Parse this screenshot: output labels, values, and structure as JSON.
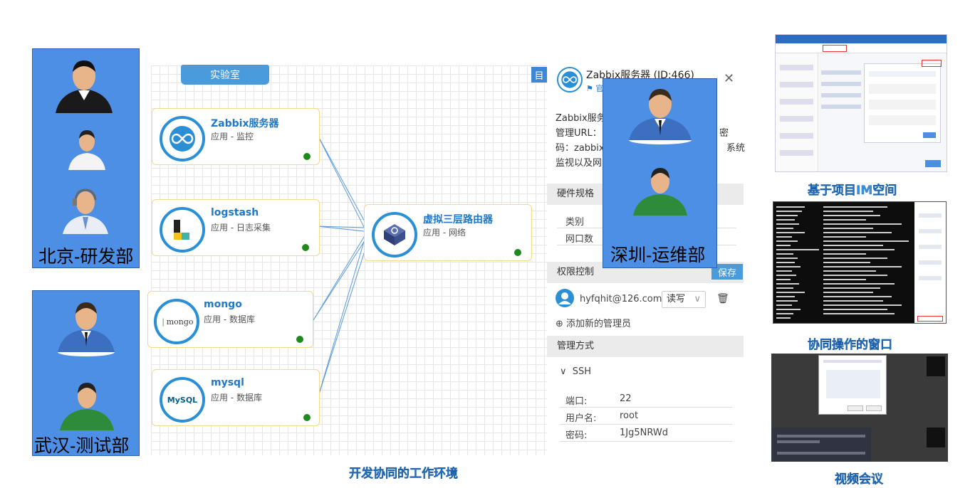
{
  "workspace": {
    "lab_tab": "实验室",
    "caption": "开发协同的工作环境",
    "corner_button": "目"
  },
  "nodes": [
    {
      "title": "Zabbix服务器",
      "subtitle": "应用 - 监控",
      "icon": "zabbix-infinity-icon"
    },
    {
      "title": "logstash",
      "subtitle": "应用 - 日志采集",
      "icon": "logstash-icon"
    },
    {
      "title": "mongo",
      "subtitle": "应用 - 数据库",
      "icon": "mongodb-icon",
      "logo_text": "mongo"
    },
    {
      "title": "mysql",
      "subtitle": "应用 - 数据库",
      "icon": "mysql-dolphin-icon",
      "logo_text": "MySQL"
    },
    {
      "title": "虚拟三层路由器",
      "subtitle": "应用 - 网络",
      "icon": "router-icon"
    }
  ],
  "groups": {
    "beijing": "北京-研发部",
    "wuhan": "武汉-测试部",
    "shenzhen": "深圳-运维部"
  },
  "panel": {
    "title": "Zabbix服务器 (ID:466)",
    "subtitle": "官",
    "desc_line1": "Zabbix服务",
    "desc_line2": "管理URL：",
    "desc_line2_end": "密",
    "desc_line3": "码：zabbix",
    "desc_line3_end": "系统",
    "desc_line4": "监视以及网",
    "hardware_section": "硬件规格",
    "hw_row1": "类别",
    "hw_row2": "网口数",
    "permission_section": "权限控制",
    "save_button": "保存",
    "admin_email": "hyfqhit@126.com",
    "permission_value": "读写",
    "add_admin": "添加新的管理员",
    "mgmt_section": "管理方式",
    "ssh_label": "SSH",
    "port_label": "端口:",
    "port_value": "22",
    "user_label": "用户名:",
    "user_value": "root",
    "pass_label": "密码:",
    "pass_value": "1Jg5NRWd"
  },
  "screenshots": [
    {
      "caption": "基于项目IM空间"
    },
    {
      "caption": "协同操作的窗口"
    },
    {
      "caption": "视频会议"
    }
  ],
  "colors": {
    "accent": "#2b8fd6",
    "group_bg": "#4e8fe6",
    "node_border": "#f3d98a",
    "status_online": "#1e8a1e",
    "caption": "#3a8fe0"
  }
}
